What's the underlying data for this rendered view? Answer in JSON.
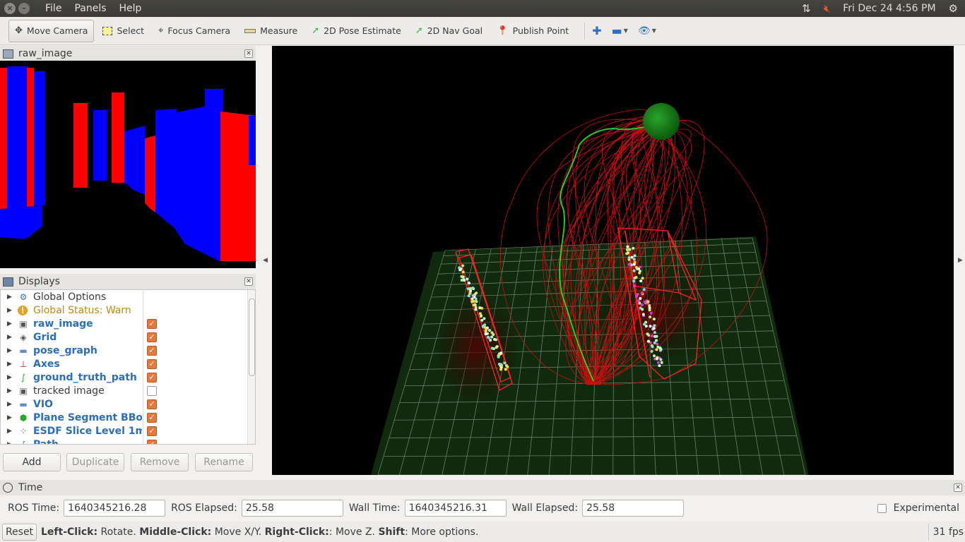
{
  "menubar": {
    "items": [
      "File",
      "Panels",
      "Help"
    ],
    "clock": "Fri Dec 24  4:56 PM"
  },
  "toolbar": {
    "tools": [
      {
        "label": "Move Camera",
        "icon": "move-camera-icon"
      },
      {
        "label": "Select",
        "icon": "select-icon"
      },
      {
        "label": "Focus Camera",
        "icon": "focus-camera-icon"
      },
      {
        "label": "Measure",
        "icon": "measure-icon"
      },
      {
        "label": "2D Pose Estimate",
        "icon": "pose-estimate-icon"
      },
      {
        "label": "2D Nav Goal",
        "icon": "nav-goal-icon"
      },
      {
        "label": "Publish Point",
        "icon": "publish-point-icon"
      }
    ]
  },
  "raw_image_panel": {
    "title": "raw_image"
  },
  "displays_panel": {
    "title": "Displays",
    "items": [
      {
        "label": "Global Options",
        "style": "normal",
        "icon": "gear-icon",
        "checked": null
      },
      {
        "label": "Global Status: Warn",
        "style": "warn",
        "icon": "warning-icon",
        "checked": null
      },
      {
        "label": "raw_image",
        "style": "bold",
        "icon": "image-icon",
        "checked": true
      },
      {
        "label": "Grid",
        "style": "bold",
        "icon": "grid-icon",
        "checked": true
      },
      {
        "label": "pose_graph",
        "style": "bold",
        "icon": "folder-icon",
        "checked": true
      },
      {
        "label": "Axes",
        "style": "bold",
        "icon": "axes-icon",
        "checked": true
      },
      {
        "label": "ground_truth_path",
        "style": "bold",
        "icon": "path-icon",
        "checked": true
      },
      {
        "label": "tracked image",
        "style": "normal",
        "icon": "image-icon",
        "checked": false
      },
      {
        "label": "VIO",
        "style": "bold",
        "icon": "folder-icon",
        "checked": true
      },
      {
        "label": "Plane Segment BBox",
        "style": "bold",
        "icon": "marker-icon",
        "checked": true
      },
      {
        "label": "ESDF Slice Level 1m",
        "style": "bold",
        "icon": "pointcloud-icon",
        "checked": true
      },
      {
        "label": "Path",
        "style": "bold",
        "icon": "path-icon",
        "checked": true
      }
    ],
    "buttons": {
      "add": "Add",
      "duplicate": "Duplicate",
      "remove": "Remove",
      "rename": "Rename"
    }
  },
  "time_panel": {
    "title": "Time",
    "ros_time_label": "ROS Time:",
    "ros_time": "1640345216.28",
    "ros_elapsed_label": "ROS Elapsed:",
    "ros_elapsed": "25.58",
    "wall_time_label": "Wall Time:",
    "wall_time": "1640345216.31",
    "wall_elapsed_label": "Wall Elapsed:",
    "wall_elapsed": "25.58",
    "experimental_label": "Experimental"
  },
  "statusbar": {
    "reset": "Reset",
    "help_parts": [
      {
        "text": "Left-Click:",
        "bold": true
      },
      {
        "text": " Rotate. ",
        "bold": false
      },
      {
        "text": "Middle-Click:",
        "bold": true
      },
      {
        "text": " Move X/Y. ",
        "bold": false
      },
      {
        "text": "Right-Click:",
        "bold": true
      },
      {
        "text": ": Move Z. ",
        "bold": false
      },
      {
        "text": "Shift",
        "bold": true
      },
      {
        "text": ": More options.",
        "bold": false
      }
    ],
    "fps": "31 fps"
  },
  "colors": {
    "accent_checkbox": "#e8773b",
    "label_blue": "#2c6fb8",
    "warn": "#c08a12",
    "path_green": "#22dd22",
    "path_red": "#cc1111"
  }
}
